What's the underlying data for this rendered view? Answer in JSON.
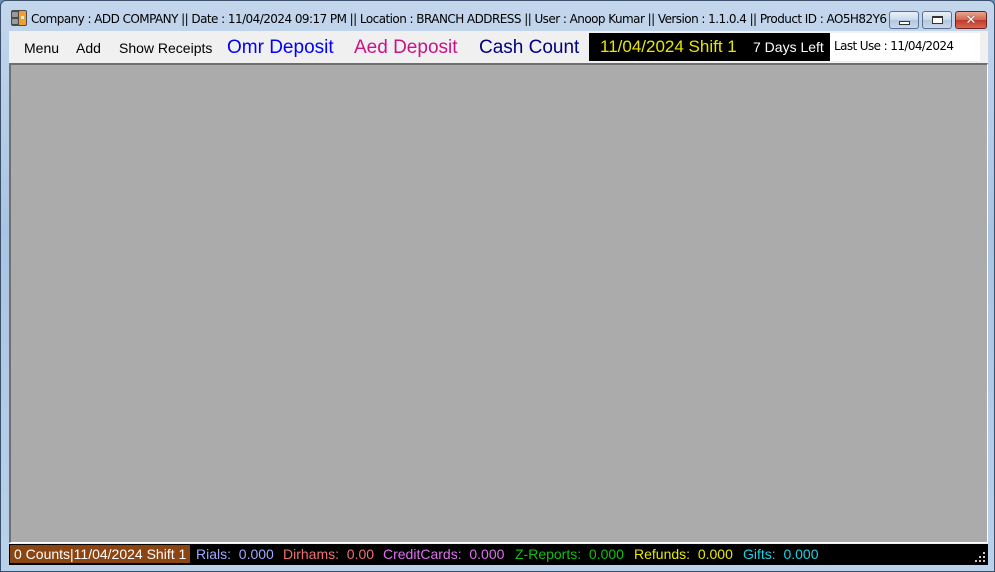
{
  "window": {
    "title": "Company : ADD COMPANY || Date : 11/04/2024 09:17 PM || Location : BRANCH ADDRESS ||  User : Anoop Kumar || Version : 1.1.0.4    || Product ID : AO5H82Y6",
    "icon": "app-icon",
    "controls": {
      "minimize": "minimize",
      "maximize": "maximize",
      "close": "✕"
    }
  },
  "menubar": {
    "items": [
      {
        "label": "Menu"
      },
      {
        "label": "Add"
      },
      {
        "label": "Show Receipts"
      }
    ],
    "actions": [
      {
        "label": "Omr Deposit",
        "color": "#0000ff"
      },
      {
        "label": "Aed Deposit",
        "color": "#c71585"
      },
      {
        "label": "Cash Count",
        "color": "#000080"
      }
    ],
    "shift": {
      "date_shift": "11/04/2024  Shift 1",
      "days_left": "7 Days Left"
    },
    "last_use": "Last Use : 11/04/2024"
  },
  "statusbar": {
    "count": "0 Counts|11/04/2024 Shift 1",
    "stats": [
      {
        "label": "Rials:",
        "value": "0.000",
        "color": "#a0a8ff"
      },
      {
        "label": "Dirhams:",
        "value": "0.00",
        "color": "#f07070"
      },
      {
        "label": "CreditCards:",
        "value": "0.000",
        "color": "#e070f0"
      },
      {
        "label": "Z-Reports:",
        "value": "0.000",
        "color": "#10c010"
      },
      {
        "label": "Refunds:",
        "value": "0.000",
        "color": "#e8e800"
      },
      {
        "label": "Gifts:",
        "value": "0.000",
        "color": "#20d0e0"
      }
    ]
  }
}
